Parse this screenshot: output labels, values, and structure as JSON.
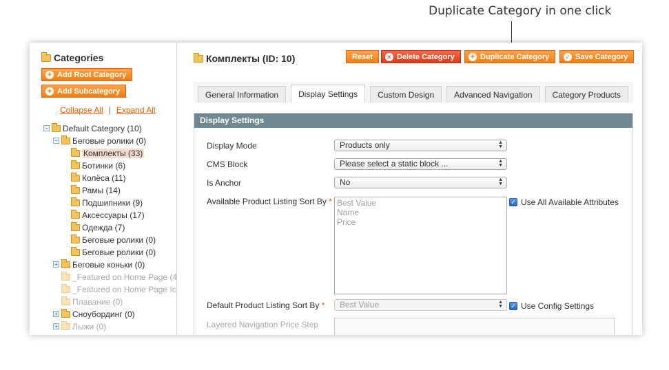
{
  "callout": {
    "text": "Duplicate Category in one click"
  },
  "sidebar": {
    "title": "Categories",
    "add_root_label": "Add Root Category",
    "add_sub_label": "Add Subcategory",
    "collapse_all": "Collapse All",
    "separator": "|",
    "expand_all": "Expand All",
    "tree": [
      {
        "label": "Default Category (10)",
        "toggle": "−"
      },
      {
        "label": "Беговые ролики (0)",
        "toggle": "−"
      },
      {
        "label": "Комплекты (33)",
        "selected": true
      },
      {
        "label": "Ботинки (6)"
      },
      {
        "label": "Колёса (11)"
      },
      {
        "label": "Рамы (14)"
      },
      {
        "label": "Подшипники (9)"
      },
      {
        "label": "Аксессуары (17)"
      },
      {
        "label": "Одежда (7)"
      },
      {
        "label": "Беговые ролики (0)"
      },
      {
        "label": "Беговые ролики (0)"
      },
      {
        "label": "Беговые коньки (0)",
        "toggle": "+"
      },
      {
        "label": "_Featured on Home Page (4",
        "faded": true
      },
      {
        "label": "_Featured on Home Page Ic",
        "faded": true
      },
      {
        "label": "Плавание (0)",
        "faded": true
      },
      {
        "label": "Сноубординг (0)",
        "toggle": "+"
      },
      {
        "label": "Лыжи (0)",
        "toggle": "+",
        "faded": true
      }
    ]
  },
  "header": {
    "title": "Комплекты (ID: 10)",
    "reset_label": "Reset",
    "delete_label": "Delete Category",
    "duplicate_label": "Duplicate Category",
    "save_label": "Save Category"
  },
  "tabs": [
    {
      "label": "General Information",
      "active": false
    },
    {
      "label": "Display Settings",
      "active": true
    },
    {
      "label": "Custom Design",
      "active": false
    },
    {
      "label": "Advanced Navigation",
      "active": false
    },
    {
      "label": "Category Products",
      "active": false
    }
  ],
  "panel": {
    "title": "Display Settings",
    "display_mode": {
      "label": "Display Mode",
      "value": "Products only"
    },
    "cms_block": {
      "label": "CMS Block",
      "value": "Please select a static block ..."
    },
    "is_anchor": {
      "label": "Is Anchor",
      "value": "No"
    },
    "sort_by": {
      "label": "Available Product Listing Sort By",
      "required": "*",
      "options": [
        "Best Value",
        "Name",
        "Price"
      ],
      "checkbox_label": "Use All Available Attributes",
      "checked": true
    },
    "default_sort": {
      "label": "Default Product Listing Sort By",
      "required": "*",
      "value": "Best Value",
      "checkbox_label": "Use Config Settings",
      "checked": true
    },
    "price_step": {
      "label": "Layered Navigation Price Step"
    }
  },
  "colors": {
    "accent": "#f27d12",
    "danger": "#dd3b1b",
    "panel_header": "#6f8992",
    "link": "#eb5e00"
  }
}
